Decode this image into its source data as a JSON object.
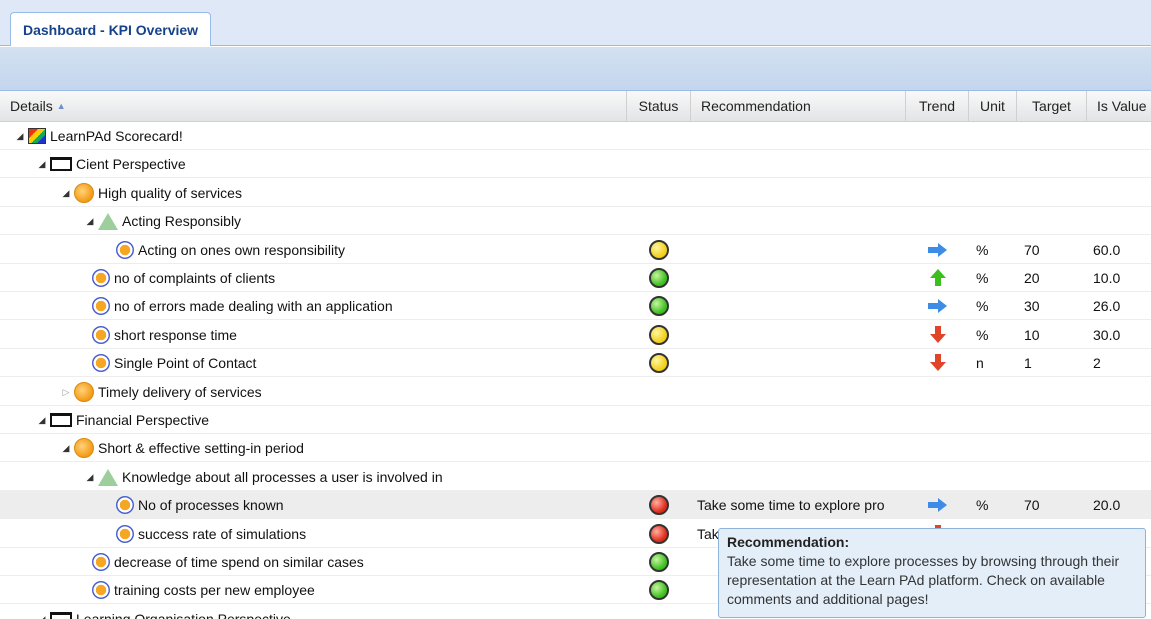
{
  "tab": {
    "title": "Dashboard - KPI Overview"
  },
  "columns": {
    "details": "Details",
    "status": "Status",
    "recommendation": "Recommendation",
    "trend": "Trend",
    "unit": "Unit",
    "target": "Target",
    "is_value": "Is Value"
  },
  "rows": [
    {
      "label": "LearnPAd Scorecard!",
      "type": "scorecard-icon",
      "state": "expanded",
      "level": 0
    },
    {
      "label": "Cient Perspective",
      "type": "perspective-icon",
      "state": "expanded",
      "level": 1
    },
    {
      "label": "High quality of services",
      "type": "objective-icon",
      "state": "expanded",
      "level": 2
    },
    {
      "label": "Acting Responsibly",
      "type": "csf-icon",
      "state": "expanded",
      "level": 3
    },
    {
      "label": "Acting on ones own responsibility",
      "type": "kpi-icon",
      "level": 4,
      "status": "yellow",
      "recommendation": "",
      "trend": "right",
      "unit": "%",
      "target": "70",
      "is_value": "60.0"
    },
    {
      "label": "no of complaints of clients",
      "type": "kpi-icon",
      "level": 3,
      "status": "green",
      "recommendation": "",
      "trend": "up",
      "unit": "%",
      "target": "20",
      "is_value": "10.0"
    },
    {
      "label": "no of errors made dealing with an application",
      "type": "kpi-icon",
      "level": 3,
      "status": "green",
      "recommendation": "",
      "trend": "right",
      "unit": "%",
      "target": "30",
      "is_value": "26.0"
    },
    {
      "label": "short response time",
      "type": "kpi-icon",
      "level": 3,
      "status": "yellow",
      "recommendation": "",
      "trend": "down",
      "unit": "%",
      "target": "10",
      "is_value": "30.0"
    },
    {
      "label": "Single Point of Contact",
      "type": "kpi-icon",
      "level": 3,
      "status": "yellow",
      "recommendation": "",
      "trend": "down",
      "unit": "n",
      "target": "1",
      "is_value": "2"
    },
    {
      "label": "Timely delivery of services",
      "type": "objective-icon",
      "state": "collapsed",
      "level": 2
    },
    {
      "label": "Financial Perspective",
      "type": "perspective-icon",
      "state": "expanded",
      "level": 1
    },
    {
      "label": "Short & effective setting-in period",
      "type": "objective-icon",
      "state": "expanded",
      "level": 2
    },
    {
      "label": "Knowledge about all processes a user is involved in",
      "type": "csf-icon",
      "state": "expanded",
      "level": 3
    },
    {
      "label": "No of processes known",
      "type": "kpi-icon",
      "level": 4,
      "status": "red",
      "recommendation": "Take some time to explore pro",
      "trend": "right",
      "unit": "%",
      "target": "70",
      "is_value": "20.0",
      "selected": true
    },
    {
      "label": "success rate of simulations",
      "type": "kpi-icon",
      "level": 4,
      "status": "red",
      "recommendation": "Tak",
      "trend": "down",
      "unit": "",
      "target": "",
      "is_value": ""
    },
    {
      "label": "decrease of time spend on similar cases",
      "type": "kpi-icon",
      "level": 3,
      "status": "green",
      "recommendation": "",
      "trend": "",
      "unit": "",
      "target": "",
      "is_value": ""
    },
    {
      "label": "training costs per new employee",
      "type": "kpi-icon",
      "level": 3,
      "status": "green",
      "recommendation": "",
      "trend": "",
      "unit": "",
      "target": "",
      "is_value": ""
    },
    {
      "label": "Learning Organisation Perspective",
      "type": "perspective-icon",
      "state": "expanded",
      "level": 1
    }
  ],
  "tooltip": {
    "title": "Recommendation:",
    "body": "Take some time to explore processes by browsing through their representation at the Learn PAd platform. Check on available comments and additional pages!"
  }
}
